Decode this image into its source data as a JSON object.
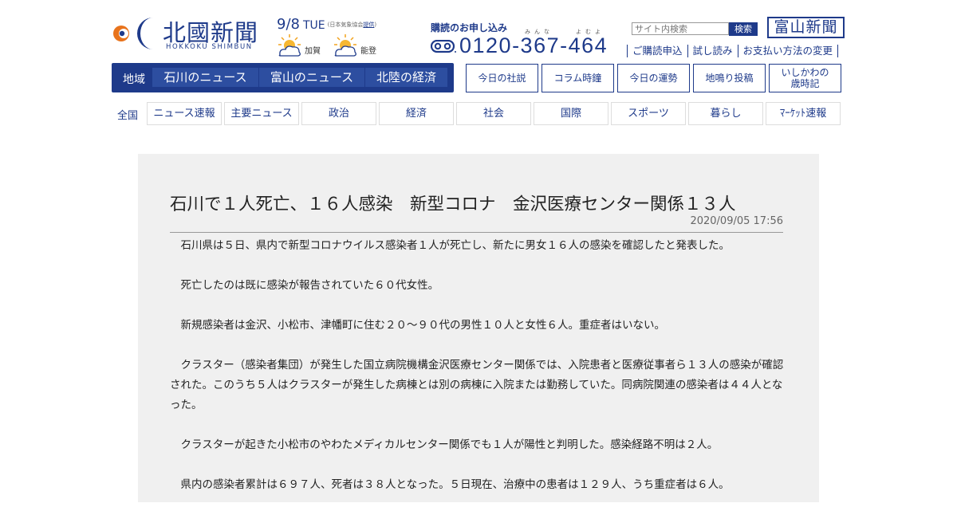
{
  "logo": {
    "title": "北國新聞",
    "subtitle": "HOKKOKU SHIMBUN"
  },
  "date": {
    "day_month": "9/8",
    "weekday": "TUE",
    "source_prefix": "(日本気象協会",
    "source_link": "提供",
    "source_suffix": ")"
  },
  "weather": [
    {
      "region": "加賀",
      "icon": "sun-cloud-icon"
    },
    {
      "region": "能登",
      "icon": "sun-cloud-icon"
    }
  ],
  "subscription": {
    "title": "購読のお申し込み",
    "furigana_1": "みんな",
    "furigana_2": "よむよ",
    "phone": "0120-367-464"
  },
  "search": {
    "placeholder": "サイト内検索",
    "button": "検索"
  },
  "toyama_logo": "富山新聞",
  "top_links": [
    "ご購読申込",
    "試し読み",
    "お支払い方法の変更"
  ],
  "region_bar": {
    "label": "地域",
    "tabs": [
      "石川のニュース",
      "富山のニュース",
      "北陸の経済"
    ]
  },
  "nav_boxes": [
    "今日の社説",
    "コラム時鐘",
    "今日の運勢",
    "地鳴り投稿",
    "いしかわの",
    "歳時記"
  ],
  "categories": {
    "label": "全国",
    "tabs": [
      "ニュース速報",
      "主要ニュース",
      "政治",
      "経済",
      "社会",
      "国際",
      "スポーツ",
      "暮らし",
      "ﾏｰｹｯﾄ速報"
    ]
  },
  "article": {
    "headline": "石川で１人死亡、１６人感染　新型コロナ　金沢医療センター関係１３人",
    "datetime": "2020/09/05 17:56",
    "paragraphs": [
      "石川県は５日、県内で新型コロナウイルス感染者１人が死亡し、新たに男女１６人の感染を確認したと発表した。",
      "死亡したのは既に感染が報告されていた６０代女性。",
      "新規感染者は金沢、小松市、津幡町に住む２０～９０代の男性１０人と女性６人。重症者はいない。",
      "クラスター（感染者集団）が発生した国立病院機構金沢医療センター関係では、入院患者と医療従事者ら１３人の感染が確認された。このうち５人はクラスターが発生した病棟とは別の病棟に入院または勤務していた。同病院関連の感染者は４４人となった。",
      "クラスターが起きた小松市のやわたメディカルセンター関係でも１人が陽性と判明した。感染経路不明は２人。",
      "県内の感染者累計は６９７人、死者は３８人となった。５日現在、治療中の患者は１２９人、うち重症者は６人。"
    ]
  },
  "colors": {
    "brand": "#1e3a8a",
    "article_bg": "#f0f0f0",
    "logo_orange": "#e8731c"
  }
}
